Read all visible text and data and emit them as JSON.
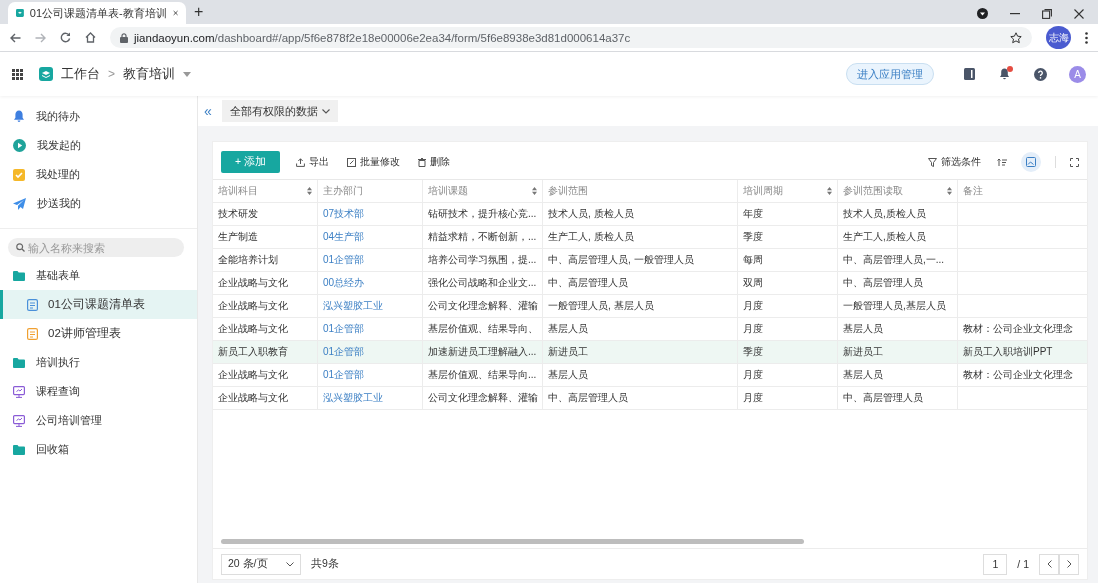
{
  "browser": {
    "tab_title": "01公司课题清单表-教育培训",
    "new_tab": "+",
    "url_host": "jiandaoyun.com",
    "url_path": "/dashboard#/app/5f6e878f2e18e00006e2ea34/form/5f6e8938e3d81d000614a37c",
    "profile": "志海"
  },
  "app_header": {
    "home": "工作台",
    "separator": ">",
    "app_name": "教育培训",
    "manage_button": "进入应用管理",
    "avatar": "A",
    "notification": true
  },
  "sidebar": {
    "items": [
      {
        "kind": "bell",
        "label": "我的待办"
      },
      {
        "kind": "play",
        "label": "我发起的"
      },
      {
        "kind": "check",
        "label": "我处理的"
      },
      {
        "kind": "send",
        "label": "抄送我的"
      }
    ],
    "search": {
      "placeholder": "输入名称来搜索"
    },
    "tree": [
      {
        "kind": "folder",
        "label": "基础表单",
        "expanded": true,
        "children": [
          {
            "kind": "form",
            "color": "#4a90d9",
            "label": "01公司课题清单表",
            "selected": true
          },
          {
            "kind": "form",
            "color": "#f0a030",
            "label": "02讲师管理表",
            "selected": false
          }
        ]
      },
      {
        "kind": "folder",
        "label": "培训执行"
      },
      {
        "kind": "screen",
        "label": "课程查询"
      },
      {
        "kind": "screen",
        "label": "公司培训管理"
      },
      {
        "kind": "folder",
        "label": "回收箱"
      }
    ]
  },
  "view_bar": {
    "collapse": "«",
    "filter_label": "全部有权限的数据"
  },
  "toolbar": {
    "add": "+ 添加",
    "export": "导出",
    "batch_edit": "批量修改",
    "delete": "删除",
    "filter": "筛选条件"
  },
  "table": {
    "columns": [
      {
        "label": "培训科目",
        "sortable": true,
        "kind": "text"
      },
      {
        "label": "主办部门",
        "sortable": false,
        "kind": "link"
      },
      {
        "label": "培训课题",
        "sortable": true,
        "kind": "text"
      },
      {
        "label": "参训范围",
        "sortable": false,
        "kind": "text"
      },
      {
        "label": "培训周期",
        "sortable": true,
        "kind": "text"
      },
      {
        "label": "参训范围读取",
        "sortable": true,
        "kind": "text"
      },
      {
        "label": "备注",
        "sortable": false,
        "kind": "text"
      }
    ],
    "rows": [
      {
        "selected": false,
        "cells": [
          "技术研发",
          "07技术部",
          "钻研技术，提升核心竞...",
          "技术人员, 质检人员",
          "年度",
          "技术人员,质检人员",
          ""
        ]
      },
      {
        "selected": false,
        "cells": [
          "生产制造",
          "04生产部",
          "精益求精，不断创新，...",
          "生产工人, 质检人员",
          "季度",
          "生产工人,质检人员",
          ""
        ]
      },
      {
        "selected": false,
        "cells": [
          "全能培养计划",
          "01企管部",
          "培养公司学习氛围，提...",
          "中、高层管理人员, 一般管理人员",
          "每周",
          "中、高层管理人员,一...",
          ""
        ]
      },
      {
        "selected": false,
        "cells": [
          "企业战略与文化",
          "00总经办",
          "强化公司战略和企业文...",
          "中、高层管理人员",
          "双周",
          "中、高层管理人员",
          ""
        ]
      },
      {
        "selected": false,
        "cells": [
          "企业战略与文化",
          "泓兴塑胶工业",
          "公司文化理念解释、灌输",
          "一般管理人员, 基层人员",
          "月度",
          "一般管理人员,基层人员",
          ""
        ]
      },
      {
        "selected": false,
        "cells": [
          "企业战略与文化",
          "01企管部",
          "基层价值观、结果导向、",
          "基层人员",
          "月度",
          "基层人员",
          "教材：公司企业文化理念"
        ]
      },
      {
        "selected": true,
        "cells": [
          "新员工入职教育",
          "01企管部",
          "加速新进员工理解融入...",
          "新进员工",
          "季度",
          "新进员工",
          "新员工入职培训PPT"
        ]
      },
      {
        "selected": false,
        "cells": [
          "企业战略与文化",
          "01企管部",
          "基层价值观、结果导向...",
          "基层人员",
          "月度",
          "基层人员",
          "教材：公司企业文化理念"
        ]
      },
      {
        "selected": false,
        "cells": [
          "企业战略与文化",
          "泓兴塑胶工业",
          "公司文化理念解释、灌输",
          "中、高层管理人员",
          "月度",
          "中、高层管理人员",
          ""
        ]
      }
    ]
  },
  "pagination": {
    "page_size": "20 条/页",
    "total": "共9条",
    "page": "1",
    "pages": "/ 1"
  }
}
